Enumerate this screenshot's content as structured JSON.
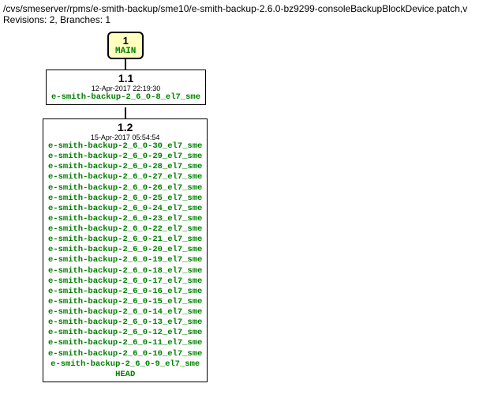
{
  "header": {
    "path": "/cvs/smeserver/rpms/e-smith-backup/sme10/e-smith-backup-2.6.0-bz9299-consoleBackupBlockDevice.patch,v",
    "info": "Revisions: 2, Branches: 1"
  },
  "branch": {
    "num": "1",
    "name": "MAIN"
  },
  "rev1": {
    "num": "1.1",
    "date": "12-Apr-2017 22:19:30",
    "tags": [
      "e-smith-backup-2_6_0-8_el7_sme"
    ]
  },
  "rev2": {
    "num": "1.2",
    "date": "15-Apr-2017 05:54:54",
    "tags": [
      "e-smith-backup-2_6_0-30_el7_sme",
      "e-smith-backup-2_6_0-29_el7_sme",
      "e-smith-backup-2_6_0-28_el7_sme",
      "e-smith-backup-2_6_0-27_el7_sme",
      "e-smith-backup-2_6_0-26_el7_sme",
      "e-smith-backup-2_6_0-25_el7_sme",
      "e-smith-backup-2_6_0-24_el7_sme",
      "e-smith-backup-2_6_0-23_el7_sme",
      "e-smith-backup-2_6_0-22_el7_sme",
      "e-smith-backup-2_6_0-21_el7_sme",
      "e-smith-backup-2_6_0-20_el7_sme",
      "e-smith-backup-2_6_0-19_el7_sme",
      "e-smith-backup-2_6_0-18_el7_sme",
      "e-smith-backup-2_6_0-17_el7_sme",
      "e-smith-backup-2_6_0-16_el7_sme",
      "e-smith-backup-2_6_0-15_el7_sme",
      "e-smith-backup-2_6_0-14_el7_sme",
      "e-smith-backup-2_6_0-13_el7_sme",
      "e-smith-backup-2_6_0-12_el7_sme",
      "e-smith-backup-2_6_0-11_el7_sme",
      "e-smith-backup-2_6_0-10_el7_sme",
      "e-smith-backup-2_6_0-9_el7_sme",
      "HEAD"
    ]
  }
}
